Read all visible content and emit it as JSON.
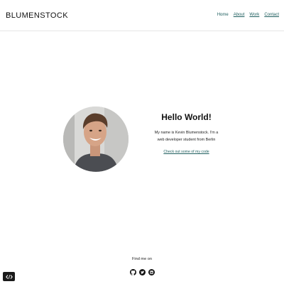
{
  "header": {
    "brand": "BLUMENSTOCK",
    "nav": [
      {
        "label": "Home"
      },
      {
        "label": "About"
      },
      {
        "label": "Work"
      },
      {
        "label": "Contact"
      }
    ]
  },
  "intro": {
    "heading": "Hello World!",
    "line1": "My name is Kevin Blumenstock. I'm a",
    "line2": "web developer student from Berlin",
    "cta": "Check out some of my code"
  },
  "footer": {
    "find_me": "Find me on",
    "socials": [
      "github-icon",
      "twitter-icon",
      "linkedin-icon"
    ]
  },
  "colors": {
    "link": "#1f5f5f",
    "text": "#111111",
    "divider": "#e6e6e6"
  }
}
